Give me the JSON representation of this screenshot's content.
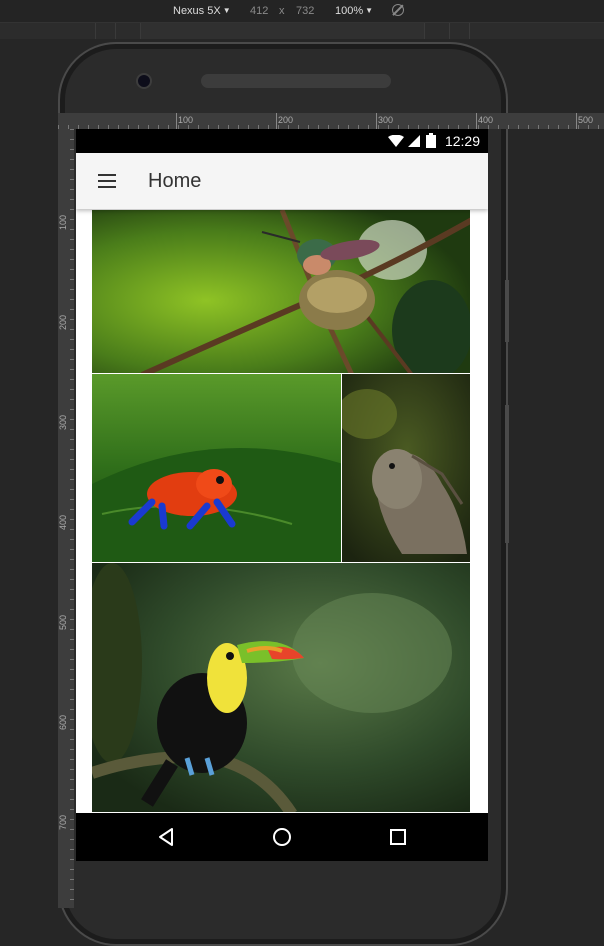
{
  "devtools": {
    "device": "Nexus 5X",
    "width": "412",
    "times": "x",
    "height": "732",
    "zoom": "100%"
  },
  "ruler": {
    "h_labels": [
      "100",
      "200",
      "300",
      "400",
      "500"
    ],
    "v_labels": [
      "100",
      "200",
      "300",
      "400",
      "500",
      "600",
      "700"
    ]
  },
  "status_bar": {
    "time": "12:29"
  },
  "app_bar": {
    "title": "Home",
    "menu_icon": "hamburger-menu-icon"
  },
  "gallery": {
    "images": [
      {
        "subject": "hummingbird-on-nest"
      },
      {
        "subject": "strawberry-poison-dart-frog"
      },
      {
        "subject": "green-iguana"
      },
      {
        "subject": "keel-billed-toucan"
      }
    ]
  },
  "nav_bar": {
    "back": "back-icon",
    "home": "home-icon",
    "recents": "recents-icon"
  }
}
